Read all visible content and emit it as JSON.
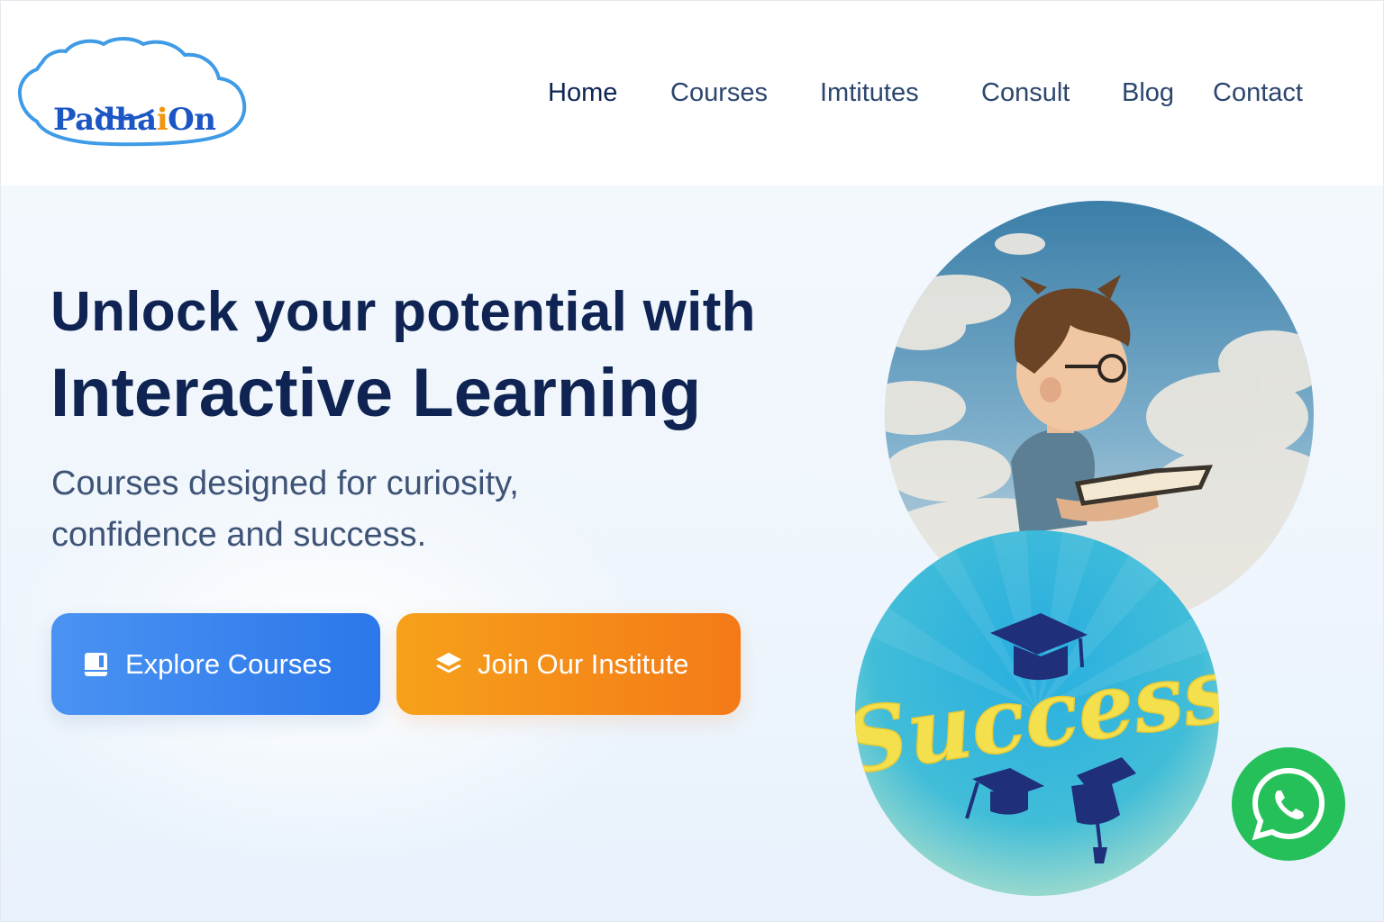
{
  "brand": {
    "logo_left": "Padha",
    "logo_accent": "i",
    "logo_right": "On",
    "colors": {
      "primary": "#1b56c4",
      "accent": "#f0960f",
      "cloud": "#3f9be6"
    }
  },
  "nav": {
    "items": [
      {
        "label": "Home",
        "active": true
      },
      {
        "label": "Courses",
        "active": false
      },
      {
        "label": "Imtitutes",
        "active": false
      },
      {
        "label": "Consult",
        "active": false
      },
      {
        "label": "Blog",
        "active": false
      },
      {
        "label": "Contact",
        "active": false
      }
    ]
  },
  "hero": {
    "headline_line1": "Unlock your potential with",
    "headline_line2": "Interactive Learning",
    "subtitle_line1": "Courses designed for curiosity,",
    "subtitle_line2": "confidence and success.",
    "colors": {
      "heading": "#0f2453",
      "body": "#3e5376"
    }
  },
  "buttons": {
    "explore_label": "Explore Courses",
    "explore_icon": "book-icon",
    "join_label": "Join Our Institute",
    "join_icon": "layers-icon",
    "colors": {
      "explore": "#2c77ea",
      "join": "#f47a18"
    }
  },
  "images": {
    "boy_image": "boy-reading-in-clouds-illustration",
    "success_badge": {
      "text": "Success",
      "icon": "graduation-cap-icon"
    }
  },
  "whatsapp": {
    "icon": "whatsapp-icon",
    "color": "#25c05a"
  }
}
